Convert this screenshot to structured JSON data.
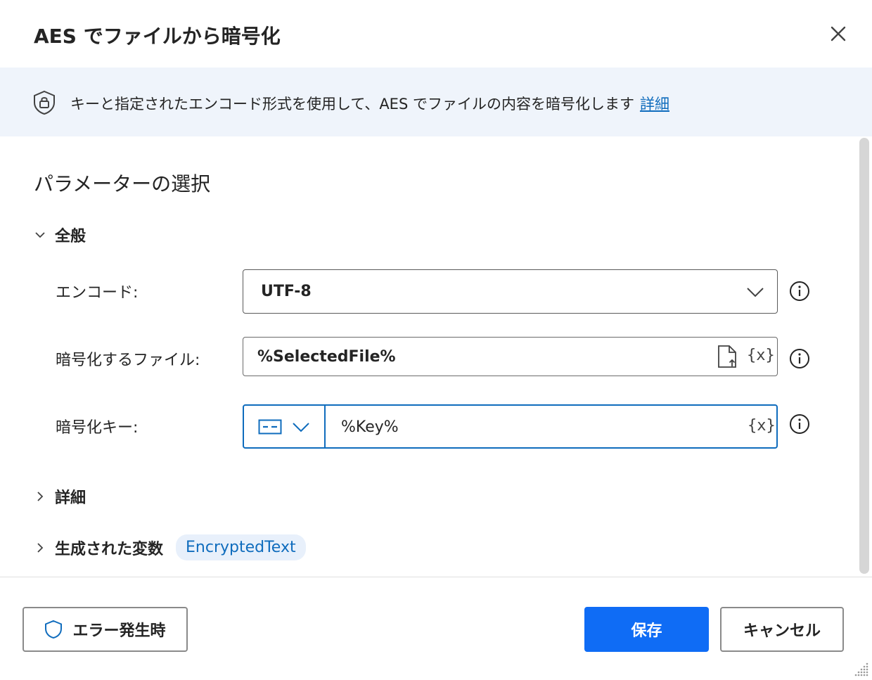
{
  "dialog": {
    "title": "AES でファイルから暗号化",
    "close_icon": "close-icon"
  },
  "banner": {
    "icon": "shield-lock-icon",
    "text": "キーと指定されたエンコード形式を使用して、AES でファイルの内容を暗号化します",
    "link_label": "詳細"
  },
  "section": {
    "title": "パラメーターの選択"
  },
  "groups": {
    "general": {
      "label": "全般",
      "expanded": true
    },
    "details": {
      "label": "詳細",
      "expanded": false
    },
    "variables": {
      "label": "生成された変数",
      "chip": "EncryptedText",
      "expanded": false
    }
  },
  "fields": {
    "encoding": {
      "label": "エンコード:",
      "value": "UTF-8",
      "type": "dropdown"
    },
    "file": {
      "label": "暗号化するファイル:",
      "value": "%SelectedFile%",
      "var_icon": "{x}"
    },
    "key": {
      "label": "暗号化キー:",
      "value": "%Key%",
      "var_icon": "{x}"
    }
  },
  "footer": {
    "error_button": "エラー発生時",
    "save_button": "保存",
    "cancel_button": "キャンセル"
  },
  "colors": {
    "accent": "#0f6cbd",
    "primary_button": "#0f6cf5",
    "banner_bg": "#eff4fb",
    "chip_bg": "#e8f0fb"
  }
}
